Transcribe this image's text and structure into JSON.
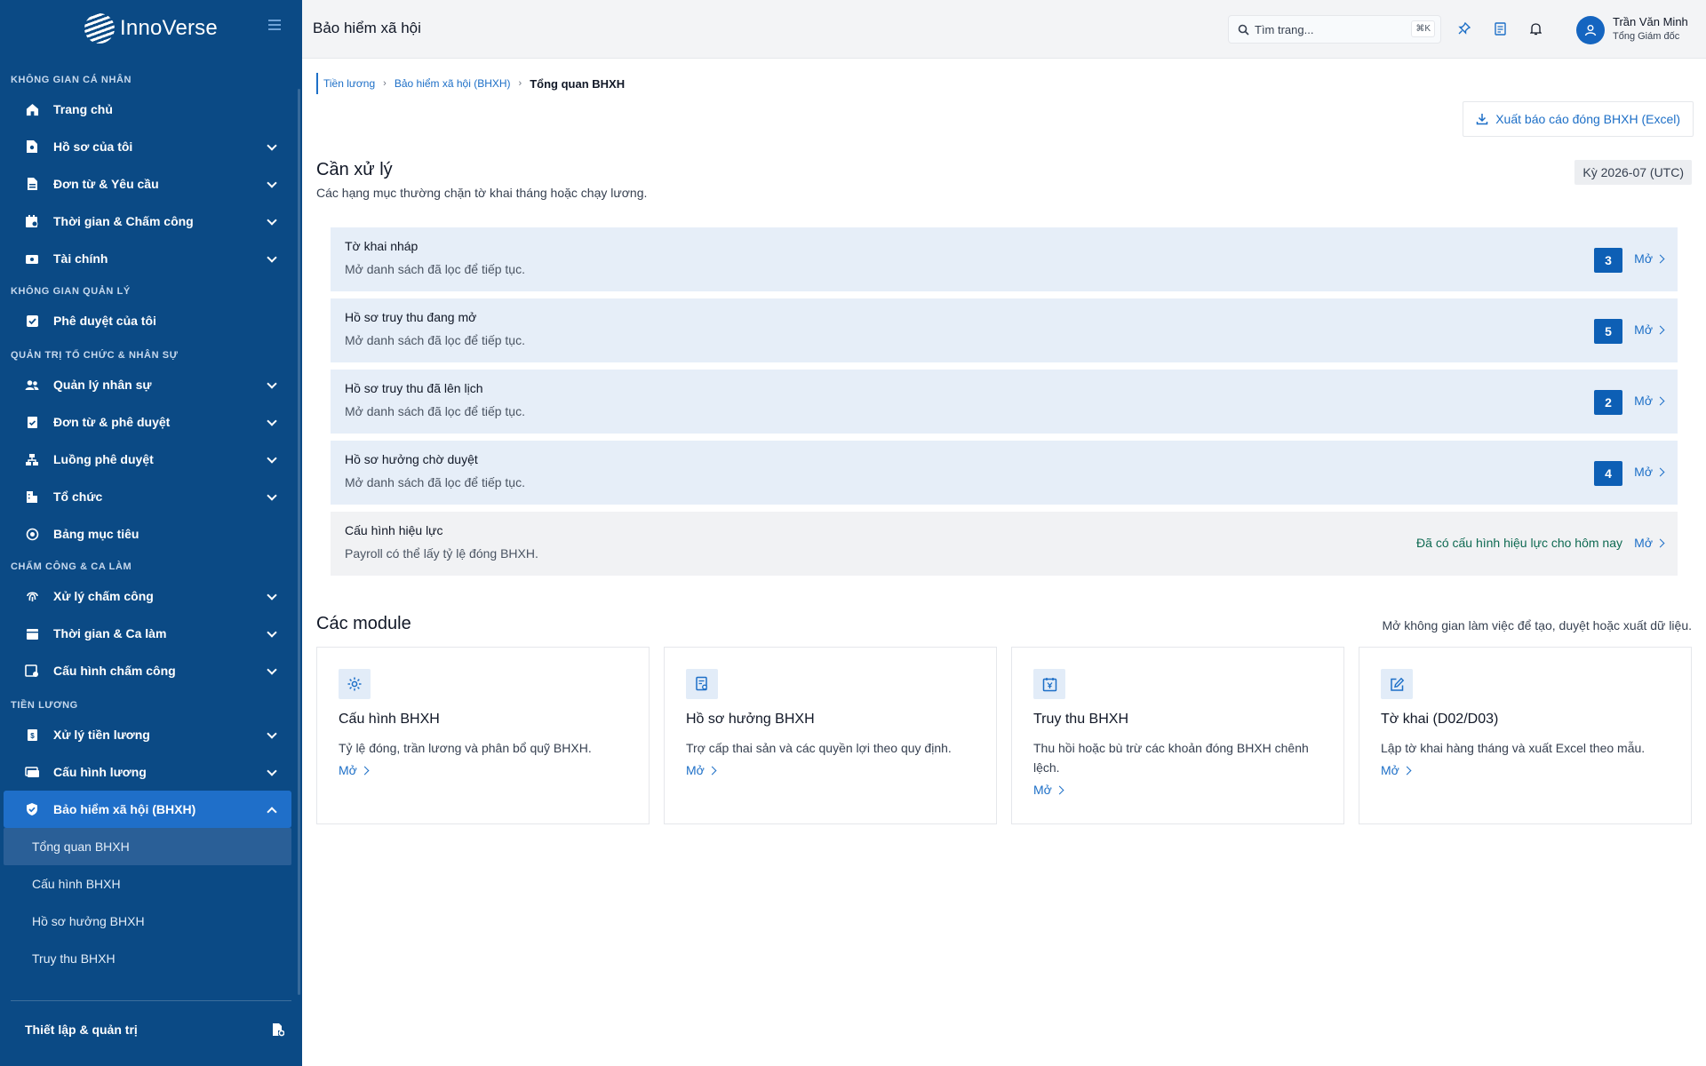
{
  "app": {
    "brand": "InnoVerse"
  },
  "sidebar": {
    "sections": {
      "personal": "KHÔNG GIAN CÁ NHÂN",
      "manage": "KHÔNG GIAN QUẢN LÝ",
      "org": "QUẢN TRỊ TỔ CHỨC & NHÂN SỰ",
      "attendance": "CHẤM CÔNG & CA LÀM",
      "payroll": "TIỀN LƯƠNG"
    },
    "items": {
      "home": "Trang chủ",
      "profile": "Hồ sơ của tôi",
      "requests": "Đơn từ & Yêu cầu",
      "time": "Thời gian & Chấm công",
      "finance": "Tài chính",
      "approvals": "Phê duyệt của tôi",
      "hr": "Quản lý nhân sự",
      "forms": "Đơn từ & phê duyệt",
      "flows": "Luồng phê duyệt",
      "org": "Tổ chức",
      "goals": "Bảng mục tiêu",
      "attendance_process": "Xử lý chấm công",
      "shifts": "Thời gian & Ca làm",
      "attendance_config": "Cấu hình chấm công",
      "payroll_process": "Xử lý tiền lương",
      "payroll_config": "Cấu hình lương",
      "bhxh": "Bảo hiểm xã hội (BHXH)"
    },
    "subitems": {
      "overview": "Tổng quan BHXH",
      "config": "Cấu hình BHXH",
      "benefits": "Hồ sơ hưởng BHXH",
      "recovery": "Truy thu BHXH"
    },
    "footer": "Thiết lập & quản trị"
  },
  "topbar": {
    "title": "Bảo hiểm xã hội",
    "search_placeholder": "Tìm trang...",
    "search_shortcut": "⌘K",
    "user_name": "Trần Văn Minh",
    "user_role": "Tổng Giám đốc"
  },
  "breadcrumb": {
    "crumb1": "Tiền lương",
    "crumb2": "Bảo hiểm xã hội (BHXH)",
    "current": "Tổng quan BHXH"
  },
  "export_label": "Xuất báo cáo đóng BHXH (Excel)",
  "pending": {
    "title": "Cần xử lý",
    "subtitle": "Các hạng mục thường chặn tờ khai tháng hoặc chạy lương.",
    "period": "Kỳ 2026-07 (UTC)",
    "open_label": "Mở",
    "items": [
      {
        "title": "Tờ khai nháp",
        "desc": "Mở danh sách đã lọc để tiếp tục.",
        "count": "3"
      },
      {
        "title": "Hồ sơ truy thu đang mở",
        "desc": "Mở danh sách đã lọc để tiếp tục.",
        "count": "5"
      },
      {
        "title": "Hồ sơ truy thu đã lên lịch",
        "desc": "Mở danh sách đã lọc để tiếp tục.",
        "count": "2"
      },
      {
        "title": "Hồ sơ hưởng chờ duyệt",
        "desc": "Mở danh sách đã lọc để tiếp tục.",
        "count": "4"
      },
      {
        "title": "Cấu hình hiệu lực",
        "desc": "Payroll có thể lấy tỷ lệ đóng BHXH.",
        "status": "Đã có cấu hình hiệu lực cho hôm nay"
      }
    ]
  },
  "modules": {
    "title": "Các module",
    "hint": "Mở không gian làm việc để tạo, duyệt hoặc xuất dữ liệu.",
    "open_label": "Mở",
    "cards": [
      {
        "title": "Cấu hình BHXH",
        "desc": "Tỷ lệ đóng, trần lương và phân bổ quỹ BHXH.",
        "icon": "gear-icon"
      },
      {
        "title": "Hồ sơ hưởng BHXH",
        "desc": "Trợ cấp thai sản và các quyền lợi theo quy định.",
        "icon": "document-check-icon"
      },
      {
        "title": "Truy thu BHXH",
        "desc": "Thu hồi hoặc bù trừ các khoản đóng BHXH chênh lệch.",
        "icon": "yen-calendar-icon"
      },
      {
        "title": "Tờ khai (D02/D03)",
        "desc": "Lập tờ khai hàng tháng và xuất Excel theo mẫu.",
        "icon": "edit-icon"
      }
    ]
  },
  "colors": {
    "sidebar": "#0b4a85",
    "accent": "#1d6fc7",
    "active": "#1f6fc9",
    "success": "#0f6a52"
  }
}
